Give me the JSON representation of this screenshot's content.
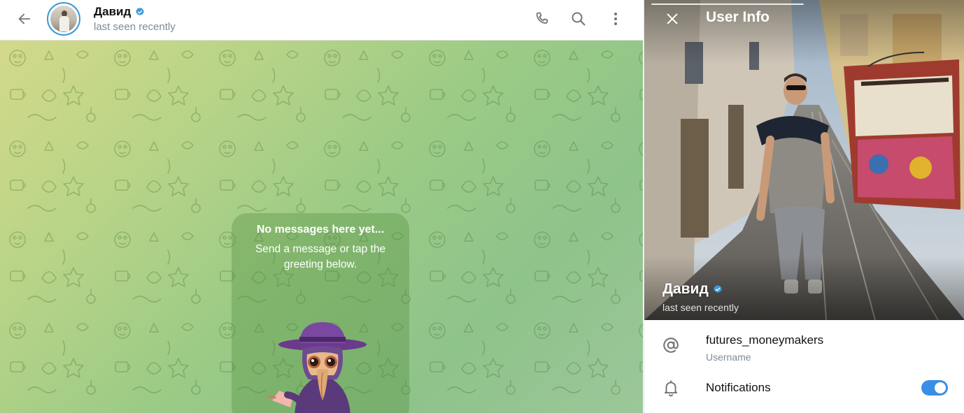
{
  "chat": {
    "contact_name": "Давид",
    "status": "last seen recently",
    "icons": {
      "back": "arrow-left-icon",
      "verified": "verified-badge-icon",
      "call": "phone-icon",
      "search": "search-icon",
      "more": "kebab-menu-icon"
    },
    "empty_state": {
      "title": "No messages here yet...",
      "subtitle": "Send a message or tap the greeting below.",
      "sticker": "plague-doctor-waving-sticker"
    }
  },
  "panel": {
    "title": "User Info",
    "close_icon": "close-icon",
    "profile_name": "Давид",
    "profile_status": "last seen recently",
    "username": {
      "value": "futures_moneymakers",
      "label": "Username",
      "icon": "at-sign-icon"
    },
    "notifications": {
      "label": "Notifications",
      "icon": "bell-icon",
      "enabled": true
    }
  },
  "colors": {
    "accent": "#3a8ee6",
    "verified": "#3a9ad9",
    "secondary_text": "#7d8b99"
  }
}
